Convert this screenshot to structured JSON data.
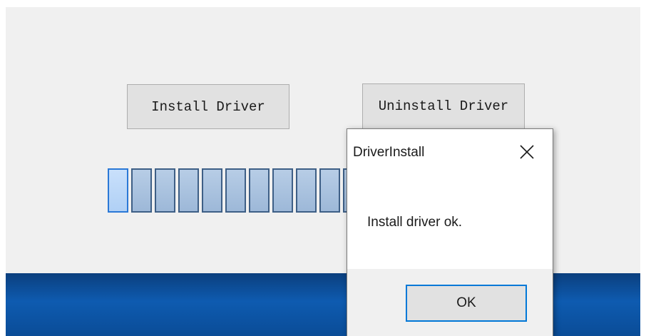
{
  "main_window": {
    "install_button": "Install Driver",
    "uninstall_button": "Uninstall Driver",
    "progress": {
      "segments_visible": 11
    }
  },
  "dialog": {
    "title": "DriverInstall",
    "message": "Install driver ok.",
    "ok_button": "OK",
    "close_icon": "close-icon"
  },
  "colors": {
    "window_bg": "#f0f0f0",
    "button_bg": "#e1e1e1",
    "accent": "#0078d7",
    "progress_fill": "#9db8d8",
    "desktop_blue": "#0e5bb0"
  }
}
